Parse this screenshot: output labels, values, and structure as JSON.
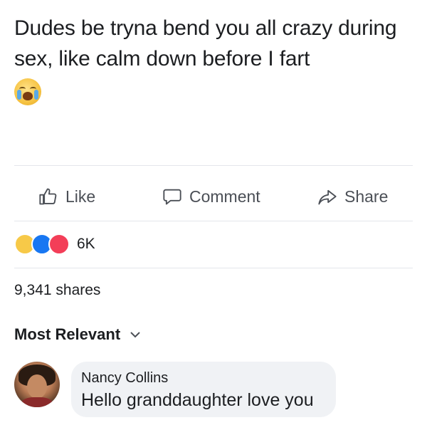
{
  "post": {
    "text": "Dudes be tryna bend you all crazy during sex, like calm down before I fart",
    "emoji": "crying-face-emoji"
  },
  "actions": {
    "like": "Like",
    "comment": "Comment",
    "share": "Share"
  },
  "reactions": {
    "icons": [
      "haha-reaction",
      "like-reaction",
      "love-reaction"
    ],
    "count": "6K"
  },
  "shares": "9,341 shares",
  "comments_sort": "Most Relevant",
  "comment": {
    "author": "Nancy Collins",
    "text": "Hello granddaughter love you"
  },
  "colors": {
    "like_blue": "#1877f2",
    "love_red": "#f33e58",
    "haha_yellow": "#f7c948",
    "bubble_bg": "#f0f2f5",
    "divider": "#e4e6eb",
    "action_gray": "#4b4f56"
  }
}
